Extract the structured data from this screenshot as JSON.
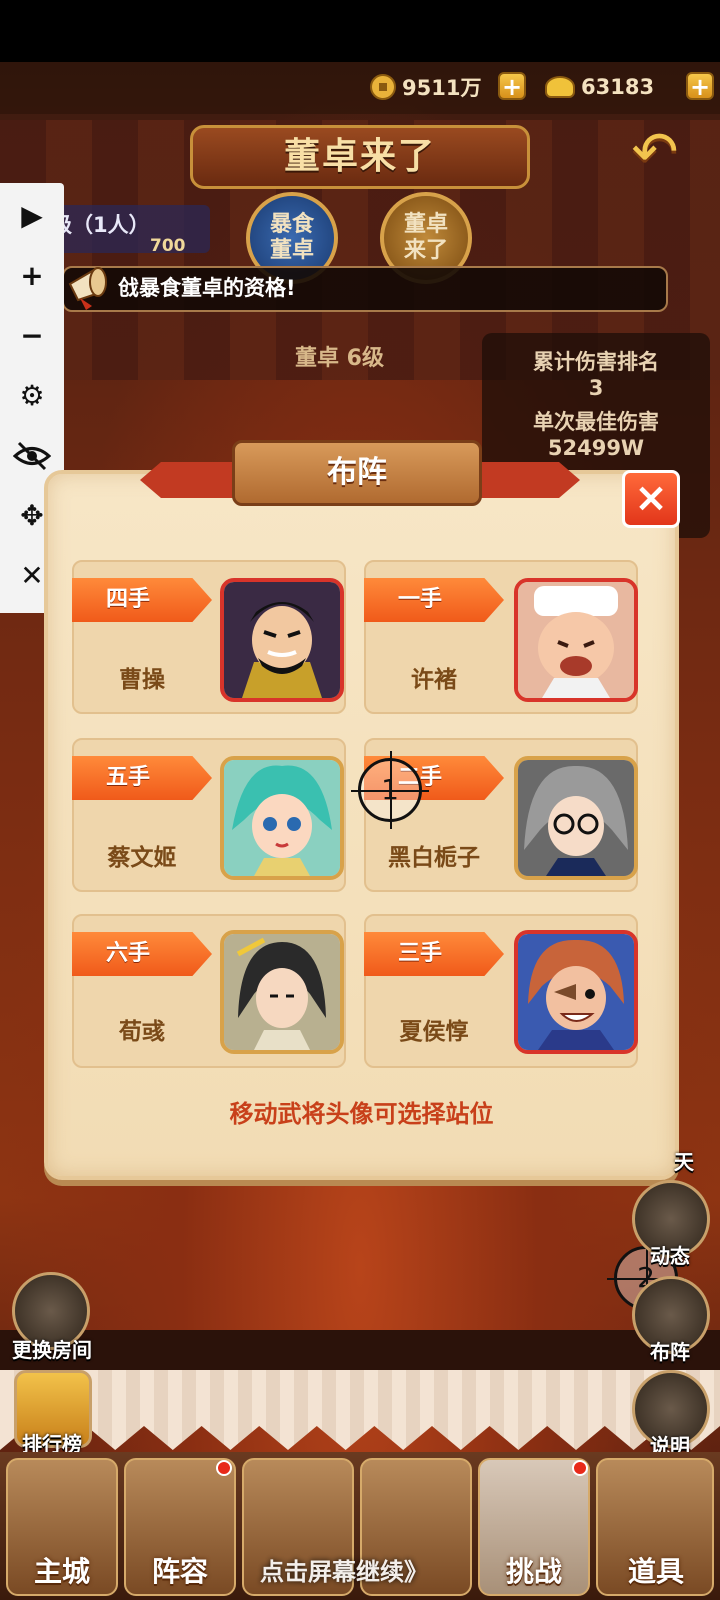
{
  "currency": {
    "coins": "9511万",
    "ingots": "63183",
    "coin_icon": "coin-icon",
    "ingot_icon": "gold-ingot-icon",
    "plus": "+"
  },
  "header": {
    "title": "董卓来了",
    "back_icon": "back-arrow-icon"
  },
  "boss_tabs": [
    {
      "label": "暴食\n董卓"
    },
    {
      "label": "董卓\n来了"
    }
  ],
  "room": {
    "rank_label": "星级（1人）",
    "gold_amount": "700",
    "notice": "戗暴食董卓的资格!",
    "boss_level": "董卓 6级"
  },
  "stats": {
    "cum_damage_label": "累计伤害排名",
    "cum_damage_rank": "3",
    "best_damage_label": "单次最佳伤害",
    "best_damage_value": "52499W"
  },
  "toolbar": {
    "items": [
      "play-icon",
      "zoom-in-icon",
      "zoom-out-icon",
      "settings-gear-icon",
      "hide-eye-icon",
      "move-arrows-icon",
      "close-x-icon"
    ]
  },
  "dialog": {
    "title": "布阵",
    "close_label": "×",
    "hint": "移动武将头像可选择站位",
    "cards": [
      {
        "order": "四手",
        "name": "曹操",
        "frame_color": "#d8342a"
      },
      {
        "order": "一手",
        "name": "许褚",
        "frame_color": "#d8342a"
      },
      {
        "order": "五手",
        "name": "蔡文姬",
        "frame_color": "#d8a24a"
      },
      {
        "order": "二手",
        "name": "黑白栀子",
        "frame_color": "#d8a24a"
      },
      {
        "order": "六手",
        "name": "荀彧",
        "frame_color": "#d8a24a"
      },
      {
        "order": "三手",
        "name": "夏侯惇",
        "frame_color": "#d8342a"
      }
    ]
  },
  "crosshairs": [
    "1",
    "2"
  ],
  "side_buttons": {
    "left": [
      {
        "label": "更换房间"
      },
      {
        "label": "排行榜"
      }
    ],
    "right": [
      {
        "label": "天"
      },
      {
        "label": "动态"
      },
      {
        "label": "布阵"
      },
      {
        "label": "说明"
      }
    ]
  },
  "bottom_nav": {
    "tabs": [
      {
        "label": "主城"
      },
      {
        "label": "阵容"
      },
      {
        "label": ""
      },
      {
        "label": ""
      },
      {
        "label": "挑战"
      },
      {
        "label": "道具"
      }
    ],
    "continue_hint": "点击屏幕继续》"
  }
}
